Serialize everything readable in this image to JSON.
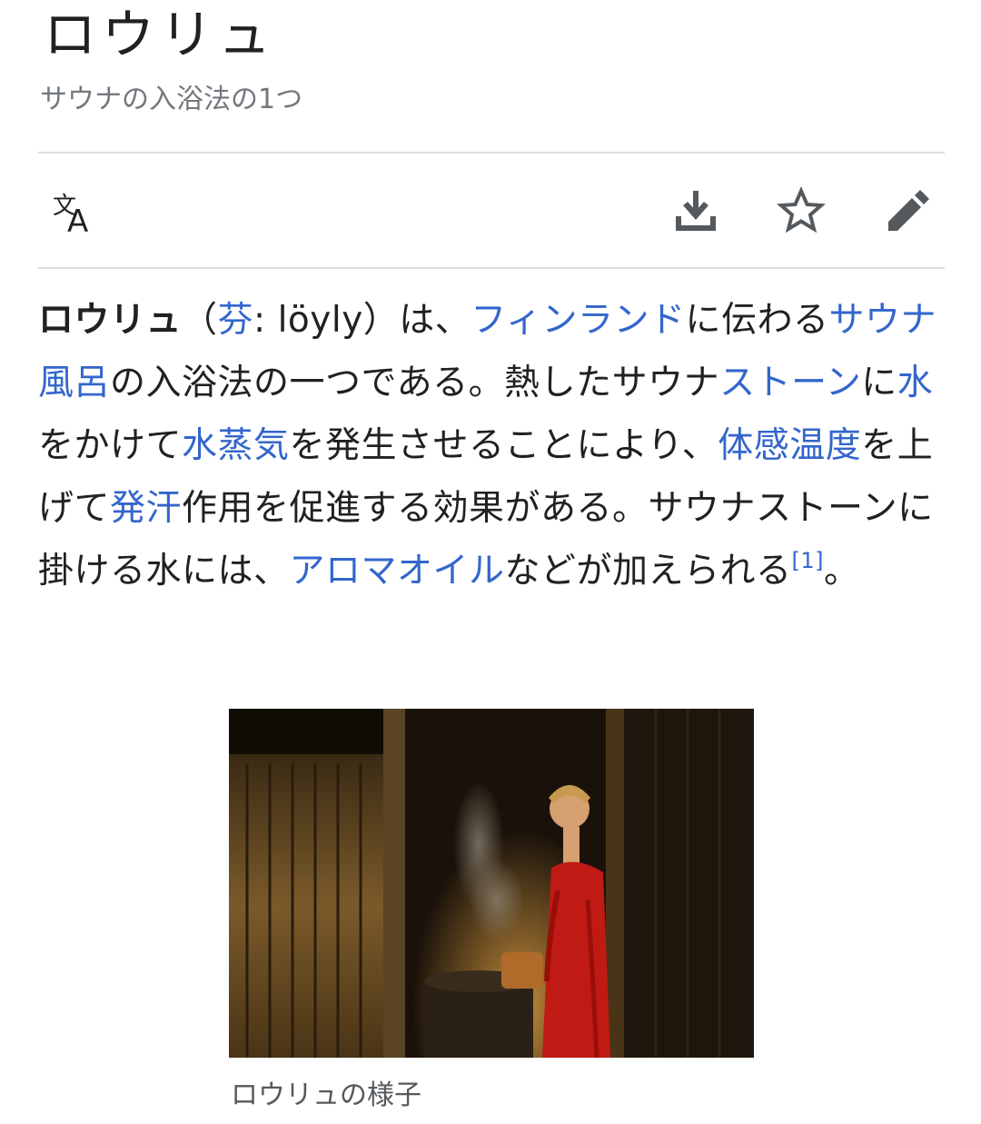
{
  "header": {
    "title": "ロウリュ",
    "subtitle": "サウナの入浴法の1つ"
  },
  "toolbar": {
    "icons": [
      "language-icon",
      "download-icon",
      "star-icon",
      "edit-icon"
    ]
  },
  "article": {
    "lead_bold": "ロウリュ",
    "open_paren": "（",
    "lang_link": "芬",
    "lang_word": ": löyly）は、",
    "link_finland": "フィンランド",
    "t_tsutawaru": "に伝わる",
    "link_sauna_bath": "サウナ風呂",
    "t_method": "の入浴法の一つである。熱したサウナ",
    "link_stone": "ストーン",
    "t_ni": "に",
    "link_water": "水",
    "t_kakete": "をかけて",
    "link_steam": "水蒸気",
    "t_hassei": "を発生させることにより、",
    "link_body_temp": "体感温度",
    "t_agete": "を上げて",
    "link_sweat": "発汗",
    "t_effect": "作用を促進する効果がある。サウナストーンに掛ける水には、",
    "link_aroma": "アロマオイル",
    "t_nado": "などが加えられる",
    "ref": "[1]",
    "t_end": "。"
  },
  "figure": {
    "caption": "ロウリュの様子"
  },
  "colors": {
    "text": "#202122",
    "link": "#3366cc",
    "muted": "#72777d",
    "divider": "#dadde1",
    "icon": "#54595d"
  }
}
